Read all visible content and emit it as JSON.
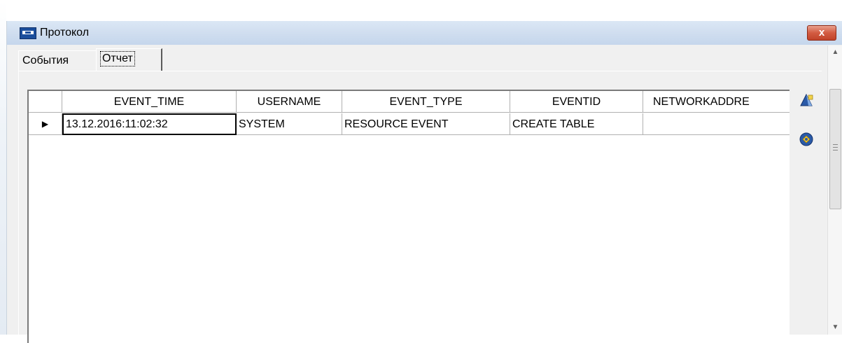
{
  "window": {
    "title": "Протокол",
    "close_label": "x"
  },
  "tabs": [
    {
      "label": "События",
      "active": false
    },
    {
      "label": "Отчет",
      "active": true
    }
  ],
  "grid": {
    "columns": [
      "EVENT_TIME",
      "USERNAME",
      "EVENT_TYPE",
      "EVENTID",
      "NETWORKADDRE"
    ],
    "rows": [
      {
        "indicator": "▶",
        "cells": [
          "13.12.2016:11:02:32",
          "SYSTEM",
          "RESOURCE EVENT",
          "CREATE TABLE",
          ""
        ]
      }
    ]
  },
  "side_buttons": [
    {
      "icon": "report-icon"
    },
    {
      "icon": "refresh-icon"
    }
  ],
  "scrollbar": {
    "up": "▲",
    "down": "▼"
  }
}
